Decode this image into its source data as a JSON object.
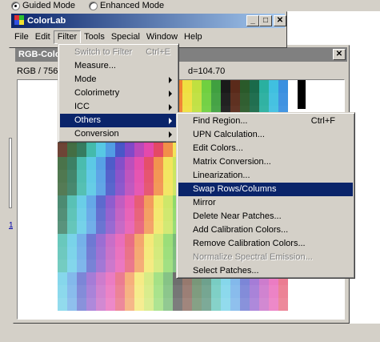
{
  "mode_bar": {
    "guided": "Guided Mode",
    "enhanced": "Enhanced Mode"
  },
  "app": {
    "title": "ColorLab",
    "menus": [
      "File",
      "Edit",
      "Filter",
      "Tools",
      "Special",
      "Window",
      "Help"
    ],
    "active_menu": "Filter",
    "caption_buttons": [
      "_",
      "□",
      "✕"
    ]
  },
  "child_window": {
    "title": "RGB-Colo",
    "info_left": "RGB / 756",
    "info_right": "d=104.70",
    "close": "✕"
  },
  "tiny_link": "1",
  "filter_menu": {
    "items": [
      {
        "label": "Switch to Filter",
        "shortcut": "Ctrl+E",
        "disabled": true,
        "submenu": false
      },
      {
        "label": "Measure...",
        "shortcut": "",
        "disabled": false,
        "submenu": false
      },
      {
        "label": "Mode",
        "shortcut": "",
        "disabled": false,
        "submenu": true
      },
      {
        "label": "Colorimetry",
        "shortcut": "",
        "disabled": false,
        "submenu": true
      },
      {
        "label": "ICC",
        "shortcut": "",
        "disabled": false,
        "submenu": true
      },
      {
        "label": "Others",
        "shortcut": "",
        "disabled": false,
        "submenu": true,
        "highlighted": true
      },
      {
        "label": "Conversion",
        "shortcut": "",
        "disabled": false,
        "submenu": true
      }
    ]
  },
  "others_menu": {
    "items": [
      {
        "label": "Find Region...",
        "shortcut": "Ctrl+F",
        "disabled": false
      },
      {
        "label": "UPN Calculation...",
        "shortcut": "",
        "disabled": false
      },
      {
        "label": "Edit Colors...",
        "shortcut": "",
        "disabled": false
      },
      {
        "label": "Matrix Conversion...",
        "shortcut": "",
        "disabled": false
      },
      {
        "label": "Linearization...",
        "shortcut": "",
        "disabled": false
      },
      {
        "label": "Swap Rows/Columns",
        "shortcut": "",
        "disabled": false,
        "highlighted": true
      },
      {
        "label": "Mirror",
        "shortcut": "",
        "disabled": false
      },
      {
        "label": "Delete Near Patches...",
        "shortcut": "",
        "disabled": false
      },
      {
        "label": "Add Calibration Colors...",
        "shortcut": "",
        "disabled": false
      },
      {
        "label": "Remove Calibration Colors...",
        "shortcut": "",
        "disabled": false
      },
      {
        "label": "Normalize Spectral Emission...",
        "shortcut": "",
        "disabled": true
      },
      {
        "label": "Select Patches...",
        "shortcut": "",
        "disabled": false
      }
    ]
  },
  "colors": {
    "title_active": "#0a246a",
    "title_inactive": "#808080",
    "menu_highlight": "#0a246a",
    "face": "#d4d0c8"
  }
}
